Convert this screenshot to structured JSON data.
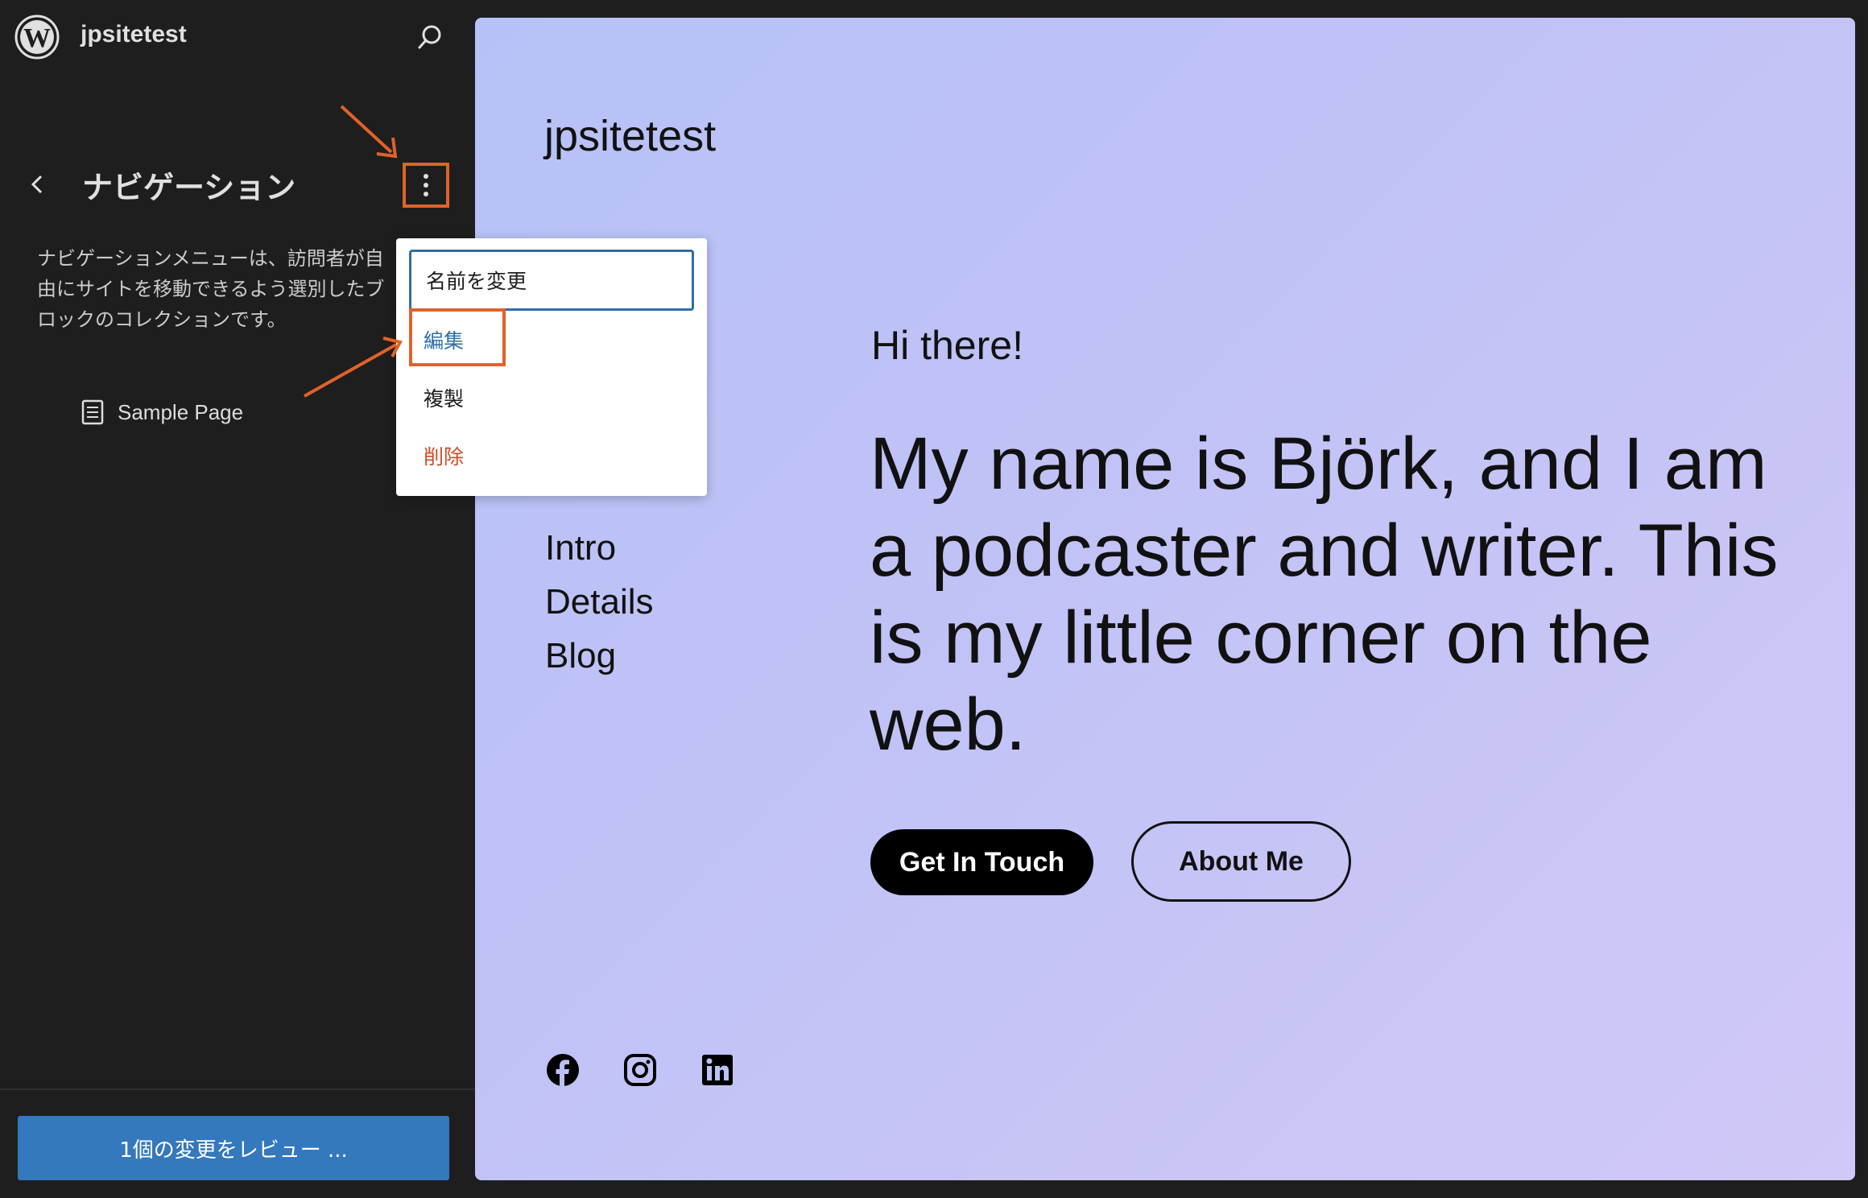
{
  "sidebar": {
    "site_name": "jpsitetest",
    "panel_title": "ナビゲーション",
    "description_lines": [
      "ナビゲーションメニューは、訪問者が自",
      "由にサイトを移動できるよう選別したブ",
      "ロックのコレクションです。"
    ],
    "nav_item": "Sample Page",
    "review_button": "1個の変更をレビュー ..."
  },
  "dropdown": {
    "items": [
      "名前を変更",
      "編集",
      "複製",
      "削除"
    ]
  },
  "preview": {
    "site_title": "jpsitetest",
    "nav_links": [
      "Intro",
      "Details",
      "Blog"
    ],
    "greeting": "Hi there!",
    "heading": "My name is Björk, and I am a podcaster and writer. This is my little corner on the web.",
    "primary_button": "Get In Touch",
    "secondary_button": "About Me",
    "social_icons": [
      "facebook-icon",
      "instagram-icon",
      "linkedin-icon"
    ]
  },
  "colors": {
    "sidebar_bg": "#1e1e1e",
    "accent_blue": "#3478bd",
    "highlight_orange": "#e0622a",
    "delete_red": "#cc4b28"
  }
}
